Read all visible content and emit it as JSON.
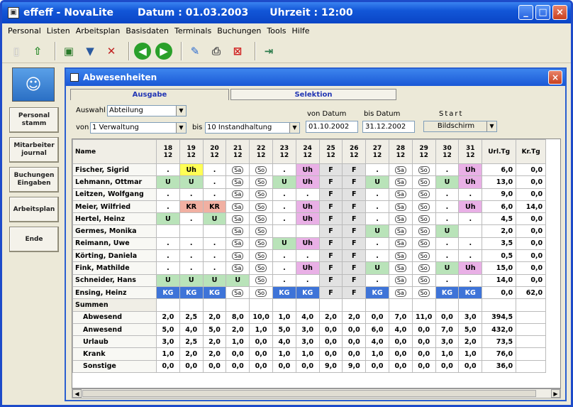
{
  "window": {
    "app": "effeff - NovaLite",
    "datum": "Datum : 01.03.2003",
    "uhrzeit": "Uhrzeit : 12:00",
    "min": "_",
    "max": "□",
    "close": "×"
  },
  "menu": [
    "Personal",
    "Listen",
    "Arbeitsplan",
    "Basisdaten",
    "Terminals",
    "Buchungen",
    "Tools",
    "Hilfe"
  ],
  "sidebar": [
    "Personal stamm",
    "Mitarbeiter journal",
    "Buchungen Eingaben",
    "Arbeitsplan",
    "Ende"
  ],
  "child": {
    "title": "Abwesenheiten",
    "close": "×"
  },
  "tabs": {
    "ausgabe": "Ausgabe",
    "selektion": "Selektion"
  },
  "filters": {
    "auswahl_label": "Auswahl",
    "auswahl_value": "Abteilung",
    "von_label": "von",
    "von_value": "1  Verwaltung",
    "bis_label": "bis",
    "bis_value": "10  Instandhaltung",
    "von_datum_label": "von Datum",
    "von_datum": "01.10.2002",
    "bis_datum_label": "bis Datum",
    "bis_datum": "31.12.2002",
    "start_label": "Start",
    "start_value": "Bildschirm"
  },
  "grid": {
    "name_header": "Name",
    "days": [
      "18",
      "19",
      "20",
      "21",
      "22",
      "23",
      "24",
      "25",
      "26",
      "27",
      "28",
      "29",
      "30",
      "31"
    ],
    "month": "12",
    "col_urltg": "Url.Tg",
    "col_krtg": "Kr.Tg",
    "rows": [
      {
        "name": "Fischer, Sigrid",
        "cells": [
          ".",
          "Uh",
          ".",
          "Sa",
          "So",
          ".",
          "Uh",
          "F",
          "F",
          ".",
          "Sa",
          "So",
          ".",
          "Uh"
        ],
        "url": "6,0",
        "kr": "0,0"
      },
      {
        "name": "Lehmann, Ottmar",
        "cells": [
          "U",
          "U",
          ".",
          "Sa",
          "So",
          "U",
          "Uh",
          "F",
          "F",
          "U",
          "Sa",
          "So",
          "U",
          "Uh"
        ],
        "url": "13,0",
        "kr": "0,0"
      },
      {
        "name": "Leitzen, Wolfgang",
        "cells": [
          ".",
          ".",
          ".",
          "Sa",
          "So",
          ".",
          ".",
          "F",
          "F",
          ".",
          "Sa",
          "So",
          ".",
          "."
        ],
        "url": "9,0",
        "kr": "0,0"
      },
      {
        "name": "Meier, Wilfried",
        "cells": [
          ".",
          "KR",
          "KR",
          "Sa",
          "So",
          ".",
          "Uh",
          "F",
          "F",
          ".",
          "Sa",
          "So",
          ".",
          "Uh"
        ],
        "url": "6,0",
        "kr": "14,0"
      },
      {
        "name": "Hertel, Heinz",
        "cells": [
          "U",
          ".",
          "U",
          "Sa",
          "So",
          ".",
          "Uh",
          "F",
          "F",
          ".",
          "Sa",
          "So",
          ".",
          "."
        ],
        "url": "4,5",
        "kr": "0,0"
      },
      {
        "name": "Germes, Monika",
        "cells": [
          "",
          "",
          "",
          "Sa",
          "So",
          "",
          "",
          "F",
          "F",
          "U",
          "Sa",
          "So",
          "U",
          ""
        ],
        "url": "2,0",
        "kr": "0,0"
      },
      {
        "name": "Reimann, Uwe",
        "cells": [
          ".",
          ".",
          ".",
          "Sa",
          "So",
          "U",
          "Uh",
          "F",
          "F",
          ".",
          "Sa",
          "So",
          ".",
          "."
        ],
        "url": "3,5",
        "kr": "0,0"
      },
      {
        "name": "Körting, Daniela",
        "cells": [
          ".",
          ".",
          ".",
          "Sa",
          "So",
          ".",
          ".",
          "F",
          "F",
          ".",
          "Sa",
          "So",
          ".",
          "."
        ],
        "url": "0,5",
        "kr": "0,0"
      },
      {
        "name": "Fink, Mathilde",
        "cells": [
          ".",
          ".",
          ".",
          "Sa",
          "So",
          ".",
          "Uh",
          "F",
          "F",
          "U",
          "Sa",
          "So",
          "U",
          "Uh"
        ],
        "url": "15,0",
        "kr": "0,0"
      },
      {
        "name": "Schneider, Hans",
        "cells": [
          "U",
          "U",
          "U",
          "U",
          "So",
          ".",
          ".",
          "F",
          "F",
          ".",
          "Sa",
          "So",
          ".",
          "."
        ],
        "url": "14,0",
        "kr": "0,0"
      },
      {
        "name": "Ensing, Heinz",
        "cells": [
          "KG",
          "KG",
          "KG",
          "Sa",
          "So",
          "KG",
          "KG",
          "F",
          "F",
          "KG",
          "Sa",
          "So",
          "KG",
          "KG"
        ],
        "url": "0,0",
        "kr": "62,0"
      }
    ],
    "summen_label": "Summen",
    "summen": [
      {
        "label": "Abwesend",
        "cells": [
          "2,0",
          "2,5",
          "2,0",
          "8,0",
          "10,0",
          "1,0",
          "4,0",
          "2,0",
          "2,0",
          "0,0",
          "7,0",
          "11,0",
          "0,0",
          "3,0"
        ],
        "url": "394,5",
        "kr": ""
      },
      {
        "label": "Anwesend",
        "cells": [
          "5,0",
          "4,0",
          "5,0",
          "2,0",
          "1,0",
          "5,0",
          "3,0",
          "0,0",
          "0,0",
          "6,0",
          "4,0",
          "0,0",
          "7,0",
          "5,0"
        ],
        "url": "432,0",
        "kr": ""
      },
      {
        "label": "Urlaub",
        "cells": [
          "3,0",
          "2,5",
          "2,0",
          "1,0",
          "0,0",
          "4,0",
          "3,0",
          "0,0",
          "0,0",
          "4,0",
          "0,0",
          "0,0",
          "3,0",
          "2,0"
        ],
        "url": "73,5",
        "kr": ""
      },
      {
        "label": "Krank",
        "cells": [
          "1,0",
          "2,0",
          "2,0",
          "0,0",
          "0,0",
          "1,0",
          "1,0",
          "0,0",
          "0,0",
          "1,0",
          "0,0",
          "0,0",
          "1,0",
          "1,0"
        ],
        "url": "76,0",
        "kr": ""
      },
      {
        "label": "Sonstige",
        "cells": [
          "0,0",
          "0,0",
          "0,0",
          "0,0",
          "0,0",
          "0,0",
          "0,0",
          "9,0",
          "9,0",
          "0,0",
          "0,0",
          "0,0",
          "0,0",
          "0,0"
        ],
        "url": "36,0",
        "kr": ""
      }
    ]
  }
}
